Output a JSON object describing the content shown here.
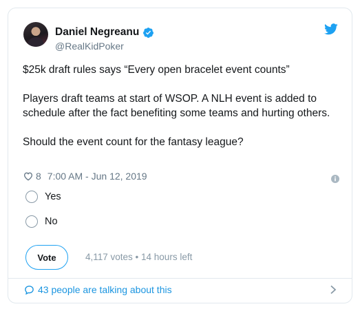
{
  "author": {
    "display_name": "Daniel Negreanu",
    "handle": "@RealKidPoker",
    "verified": true
  },
  "tweet": {
    "paragraphs": [
      "$25k draft rules says “Every open bracelet event counts”",
      "Players draft teams at start of WSOP. A NLH event is added to schedule after the fact benefiting some teams and hurting others.",
      "Should the event count for the fantasy league?"
    ],
    "likes": "8",
    "timestamp": "7:00 AM - Jun 12, 2019"
  },
  "poll": {
    "options": [
      {
        "label": "Yes"
      },
      {
        "label": "No"
      }
    ],
    "vote_label": "Vote",
    "status": "4,117 votes • 14 hours left"
  },
  "footer": {
    "talking_text": "43 people are talking about this"
  },
  "colors": {
    "accent": "#1da1f2",
    "link": "#1b95e0",
    "secondary_text": "#657786",
    "border": "#e1e8ed"
  },
  "icons": [
    "verified-badge-icon",
    "twitter-bird-icon",
    "heart-icon",
    "info-icon",
    "speech-bubble-icon",
    "chevron-right-icon"
  ]
}
